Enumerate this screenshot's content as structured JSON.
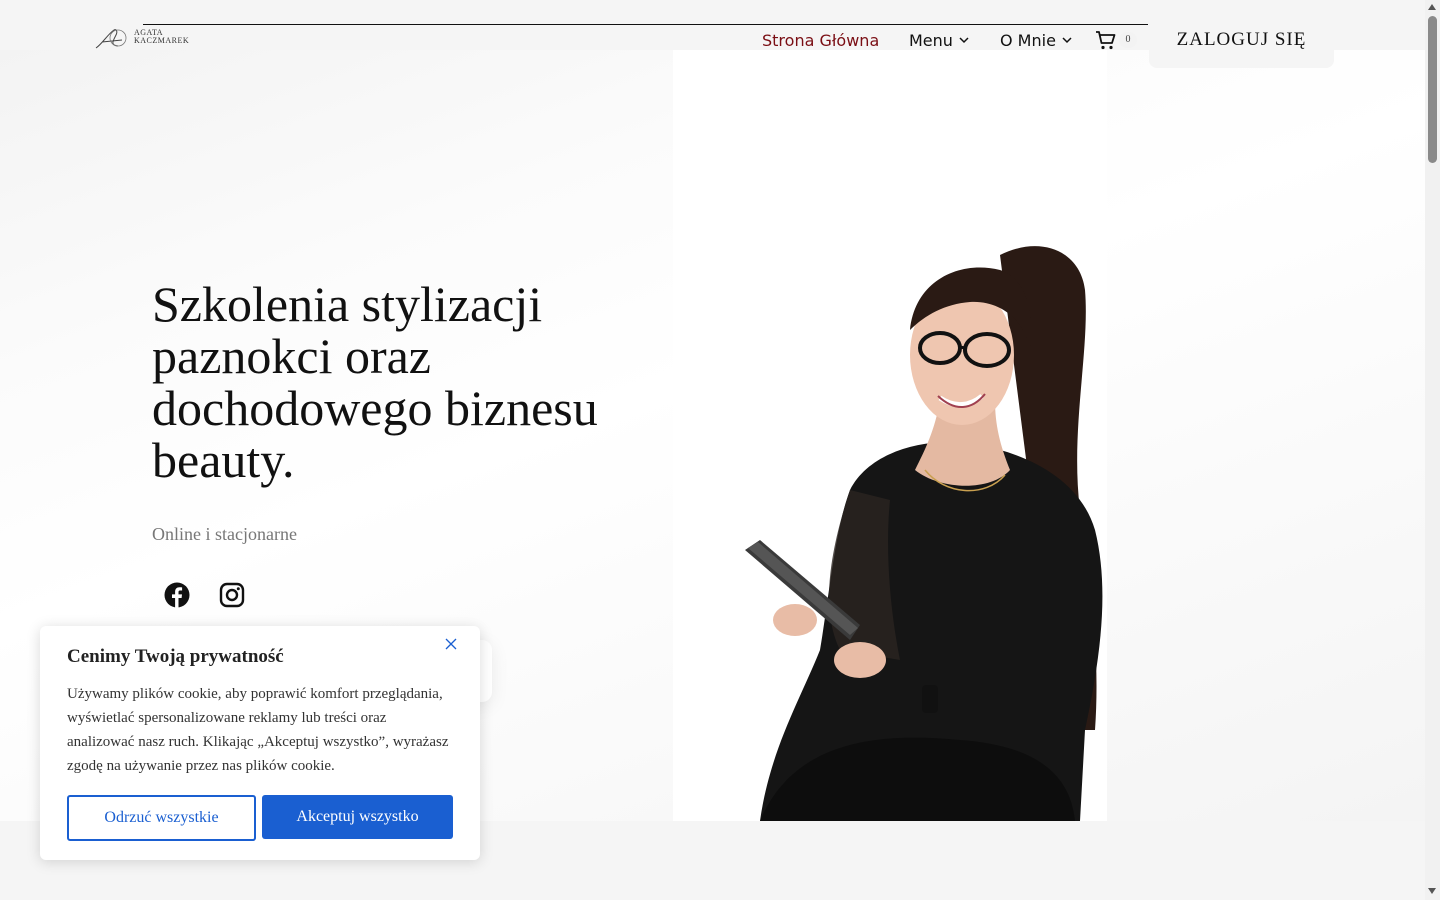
{
  "header": {
    "logo_text_line1": "AGATA",
    "logo_text_line2": "KACZMAREK",
    "nav": {
      "home": "Strona Główna",
      "menu": "Menu",
      "about": "O Mnie"
    },
    "cart_count": "0",
    "login_label": "ZALOGUJ SIĘ"
  },
  "hero": {
    "headline": "Szkolenia stylizacji paznokci oraz dochodowego biznesu beauty.",
    "subtitle": "Online i stacjonarne",
    "social": [
      "facebook-icon",
      "instagram-icon"
    ]
  },
  "cookie": {
    "title": "Cenimy Twoją prywatność",
    "text": "Używamy plików cookie, aby poprawić komfort przeglądania, wyświetlać spersonalizowane reklamy lub treści oraz analizować nasz ruch. Klikając „Akceptuj wszystko”, wyrażasz zgodę na używanie przez nas plików cookie.",
    "reject_label": "Odrzuć wszystkie",
    "accept_label": "Akceptuj wszystko"
  },
  "colors": {
    "accent_nav": "#7a0e14",
    "cookie_blue": "#1a5fd1"
  }
}
